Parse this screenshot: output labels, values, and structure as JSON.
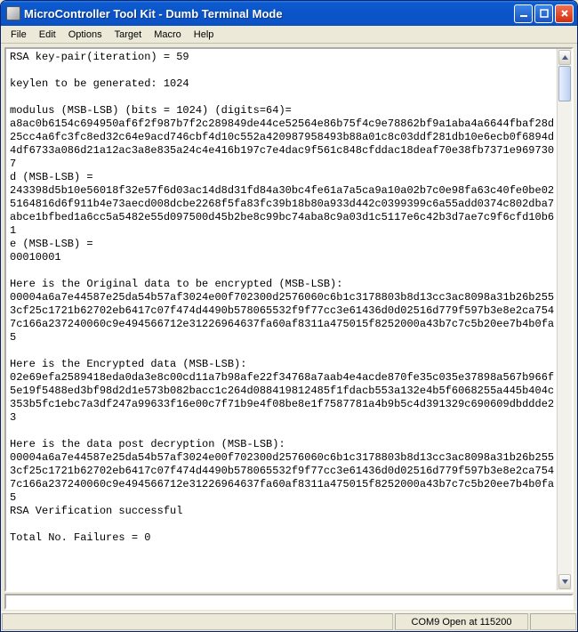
{
  "window": {
    "title": "MicroController Tool Kit - Dumb Terminal Mode",
    "buttons": {
      "minimize": "–",
      "maximize": "□",
      "close": "×"
    }
  },
  "menu": {
    "items": [
      "File",
      "Edit",
      "Options",
      "Target",
      "Macro",
      "Help"
    ]
  },
  "terminal": {
    "lines": [
      "RSA key-pair(iteration) = 59",
      "",
      "keylen to be generated: 1024",
      "",
      "modulus (MSB-LSB) (bits = 1024) (digits=64)=",
      "a8ac0b6154c694950af6f2f987b7f2c289849de44ce52564e86b75f4c9e78862bf9a1aba4a6644fbaf28d25cc4a6fc3fc8ed32c64e9acd746cbf4d10c552a420987958493b88a01c8c03ddf281db10e6ecb0f6894d4df6733a086d21a12ac3a8e835a24c4e416b197c7e4dac9f561c848cfddac18deaf70e38fb7371e9697307",
      "d (MSB-LSB) =",
      "243398d5b10e56018f32e57f6d03ac14d8d31fd84a30bc4fe61a7a5ca9a10a02b7c0e98fa63c40fe0be025164816d6f911b4e73aecd008dcbe2268f5fa83fc39b18b80a933d442c0399399c6a55add0374c802dba7abce1bfbed1a6cc5a5482e55d097500d45b2be8c99bc74aba8c9a03d1c5117e6c42b3d7ae7c9f6cfd10b61",
      "e (MSB-LSB) =",
      "00010001",
      "",
      "Here is the Original data to be encrypted (MSB-LSB):",
      "00004a6a7e44587e25da54b57af3024e00f702300d2576060c6b1c3178803b8d13cc3ac8098a31b26b2553cf25c1721b62702eb6417c07f474d4490b578065532f9f77cc3e61436d0d02516d779f597b3e8e2ca7547c166a237240060c9e494566712e31226964637fa60af8311a475015f8252000a43b7c7c5b20ee7b4b0fa5",
      "",
      "Here is the Encrypted data (MSB-LSB):",
      "02e69efa2589418eda0da3e8c00cd11a7b98afe22f34768a7aab4e4acde870fe35c035e37898a567b966f5e19f5488ed3bf98d2d1e573b082bacc1c264d088419812485f1fdacb553a132e4b5f6068255a445b404c353b5fc1ebc7a3df247a99633f16e00c7f71b9e4f08be8e1f7587781a4b9b5c4d391329c690609dbddde23",
      "",
      "Here is the data post decryption (MSB-LSB):",
      "00004a6a7e44587e25da54b57af3024e00f702300d2576060c6b1c3178803b8d13cc3ac8098a31b26b2553cf25c1721b62702eb6417c07f474d4490b578065532f9f77cc3e61436d0d02516d779f597b3e8e2ca7547c166a237240060c9e494566712e31226964637fa60af8311a475015f8252000a43b7c7c5b20ee7b4b0fa5",
      "RSA Verification successful",
      "",
      "Total No. Failures = 0",
      ""
    ]
  },
  "status": {
    "left": "",
    "center": "COM9 Open at 115200",
    "right": ""
  }
}
